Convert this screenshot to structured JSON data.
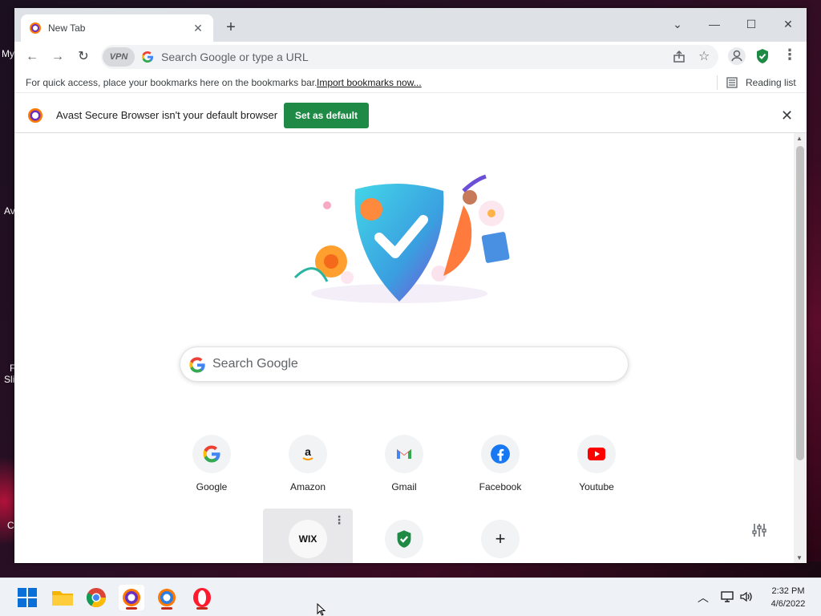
{
  "desktop": {
    "items": [
      "My",
      "Av",
      "F",
      "Sli",
      "C"
    ]
  },
  "browser": {
    "tab_title": "New Tab",
    "address_placeholder": "Search Google or type a URL",
    "vpn_label": "VPN",
    "bookmarks_bar": {
      "hint": "For quick access, place your bookmarks here on the bookmarks bar.",
      "import_link": "Import bookmarks now...",
      "reading_list": "Reading list"
    },
    "infobar": {
      "message": "Avast Secure Browser isn't your default browser",
      "button": "Set as default"
    },
    "ntp": {
      "search_placeholder": "Search Google",
      "shortcuts": [
        {
          "label": "Google",
          "icon": "google-icon"
        },
        {
          "label": "Amazon",
          "icon": "amazon-icon"
        },
        {
          "label": "Gmail",
          "icon": "gmail-icon"
        },
        {
          "label": "Facebook",
          "icon": "facebook-icon"
        },
        {
          "label": "Youtube",
          "icon": "youtube-icon"
        }
      ],
      "shortcuts_row2": [
        {
          "label": "WIX",
          "icon": "wix-icon"
        },
        {
          "label": "",
          "icon": "avast-shield-icon"
        },
        {
          "label": "",
          "icon": "add-shortcut-icon"
        }
      ]
    }
  },
  "taskbar": {
    "apps": [
      "windows-start-icon",
      "file-explorer-icon",
      "chrome-icon",
      "avast-browser-icon",
      "avast-browser-icon",
      "opera-icon"
    ],
    "time": "2:32 PM",
    "date": "4/6/2022"
  },
  "colors": {
    "accent_green": "#1e8a45",
    "tab_strip": "#dee1e6",
    "taskbar": "#eef1f5"
  }
}
